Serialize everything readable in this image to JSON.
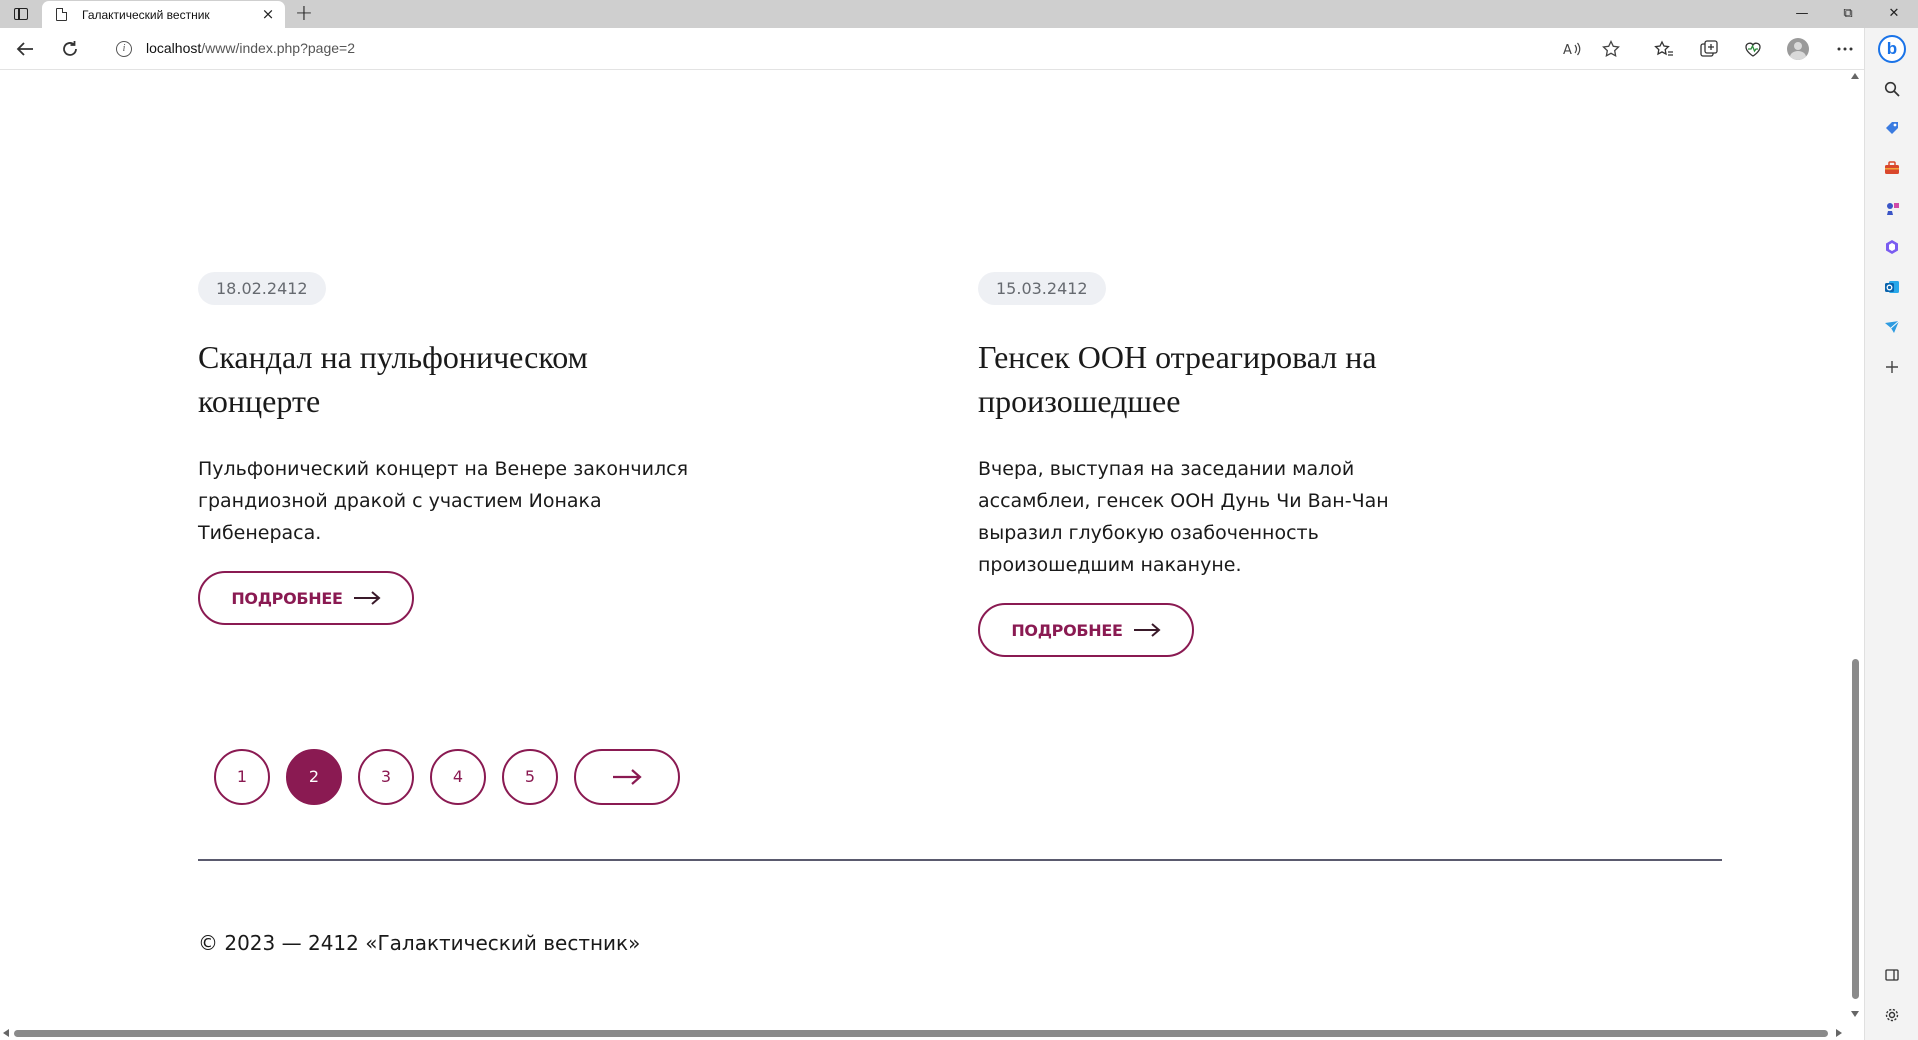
{
  "browser": {
    "tab_title": "Галактический вестник",
    "url_host": "localhost",
    "url_path": "/www/index.php?page=2",
    "new_tab_glyph": "+",
    "close_tab_glyph": "×"
  },
  "articles": [
    {
      "date": "18.02.2412",
      "title": "Скандал на пульфоническом концерте",
      "text": "Пульфонический концерт на Венере закончился грандиозной дракой с участием Ионака Тибенераса.",
      "button_label": "ПОДРОБНЕЕ"
    },
    {
      "date": "15.03.2412",
      "title": "Генсек ООН отреагировал на произошедшее",
      "text": "Вчера, выступая на заседании малой ассамблеи, генсек ООН Дунь Чи Ван-Чан выразил глубокую озабоченность произошедшим накануне.",
      "button_label": "ПОДРОБНЕЕ"
    }
  ],
  "pagination": {
    "pages": [
      "1",
      "2",
      "3",
      "4",
      "5"
    ],
    "current_page": "2"
  },
  "footer": {
    "copyright": "© 2023 — 2412 «Галактический вестник»"
  },
  "colors": {
    "accent": "#8a1a52",
    "badge_bg": "#eef0f4",
    "divider": "#5a5a6e"
  },
  "icons": {
    "tab_favicon": "page-icon",
    "toolbar": [
      "back-arrow-icon",
      "refresh-icon",
      "info-icon",
      "read-aloud-icon",
      "favorite-star-icon",
      "favorites-icon",
      "collections-icon",
      "browser-essentials-icon",
      "profile-icon",
      "more-icon"
    ],
    "sidebar": [
      "bing-icon",
      "search-icon",
      "shopping-tag-icon",
      "tools-icon",
      "games-icon",
      "office-icon",
      "outlook-icon",
      "send-icon",
      "add-icon",
      "split-view-icon",
      "settings-icon"
    ]
  }
}
